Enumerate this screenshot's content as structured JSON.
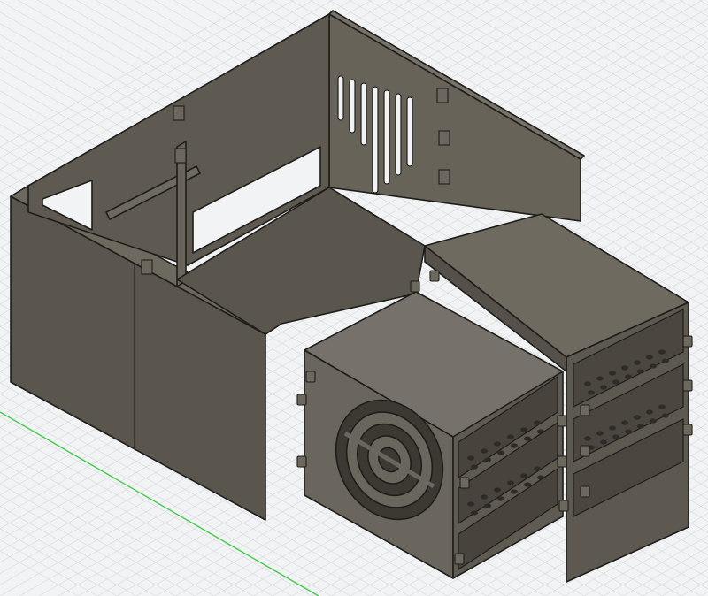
{
  "viewport": {
    "background": "#f2f3f4",
    "grid_color": "#d9dcdf",
    "axis_color": "#43c94a"
  },
  "model": {
    "face_light": "#7a756b",
    "face_mid": "#6b665d",
    "face_dark": "#575349",
    "interior": "#4a463f",
    "edge": "#1e1d1a",
    "parts": [
      "enclosure-body",
      "back-wall-vent-slots",
      "fan-module-left",
      "fan-guard",
      "drive-cage-right",
      "snap-clips"
    ]
  }
}
